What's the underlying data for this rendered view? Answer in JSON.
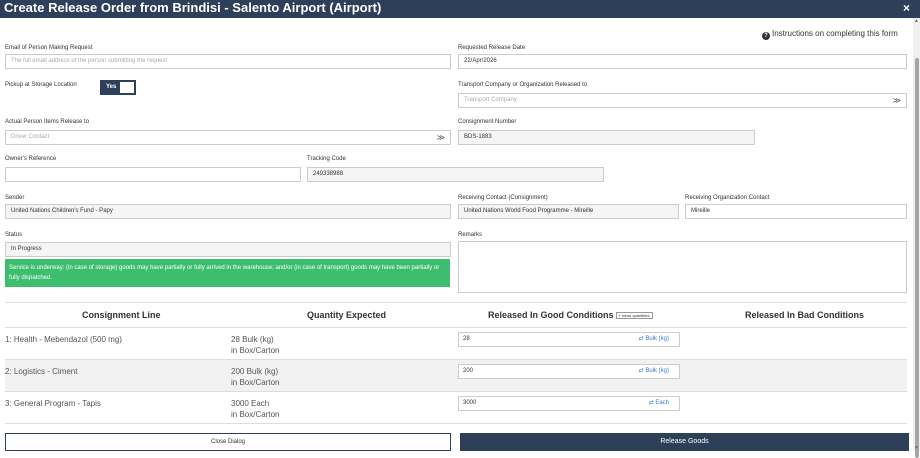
{
  "dialog": {
    "title": "Create Release Order from Brindisi - Salento Airport (Airport)",
    "close_glyph": "×"
  },
  "instructions": {
    "icon": "question-circle-icon",
    "text": "Instructions on completing this form"
  },
  "form": {
    "email": {
      "label": "Email of Person Making Request",
      "placeholder": "The full email address of the person submitting the request"
    },
    "requested_release_date": {
      "label": "Requested Release Date",
      "value": "22/Apr/2026"
    },
    "pickup": {
      "label": "Pickup at Storage Location",
      "value": "Yes"
    },
    "transport_company": {
      "label": "Transport Company or Organization Released to",
      "placeholder": "Transport Company"
    },
    "actual_person": {
      "label": "Actual Person Items Release to",
      "placeholder": "Driver Contact"
    },
    "consignment_number": {
      "label": "Consignment Number",
      "value": "BDS-1883"
    },
    "owners_reference": {
      "label": "Owner's Reference",
      "value": ""
    },
    "tracking_code": {
      "label": "Tracking Code",
      "value": "249338988"
    },
    "sender": {
      "label": "Sender",
      "value": "United Nations Children's Fund - Papy"
    },
    "receiving_contact": {
      "label": "Receiving Contact (Consignment)",
      "value": "United Nations World Food Programme - Mireille"
    },
    "receiving_org_contact": {
      "label": "Receiving Organization Contact",
      "value": "Mireille"
    },
    "status": {
      "label": "Status",
      "value": "In Progress",
      "description": "Service is underway: (in case of storage) goods may have partially or fully arrived in the warehouse; and/or (in case of transport) goods may have been partially or fully dispatched."
    },
    "remarks": {
      "label": "Remarks",
      "value": ""
    }
  },
  "table": {
    "headers": {
      "line": "Consignment Line",
      "expected": "Quantity Expected",
      "good": "Released In Good Conditions",
      "new_quantities": "+ news quantities",
      "bad": "Released In Bad Conditions"
    },
    "rows": [
      {
        "line": "1: Health - Mebendazol (500 mg)",
        "expected": "28 Bulk (kg)",
        "pack": "in Box/Carton",
        "good_value": "28",
        "unit": "Bulk (kg)"
      },
      {
        "line": "2: Logistics - Ciment",
        "expected": "200 Bulk (kg)",
        "pack": "in Box/Carton",
        "good_value": "200",
        "unit": "Bulk (kg)"
      },
      {
        "line": "3: General Program - Tapis",
        "expected": "3000 Each",
        "pack": "in Box/Carton",
        "good_value": "3000",
        "unit": "Each"
      }
    ],
    "swap_glyph": "⇄"
  },
  "buttons": {
    "close": "Close Dialog",
    "release": "Release Goods"
  },
  "glyphs": {
    "chevron": "≫"
  }
}
